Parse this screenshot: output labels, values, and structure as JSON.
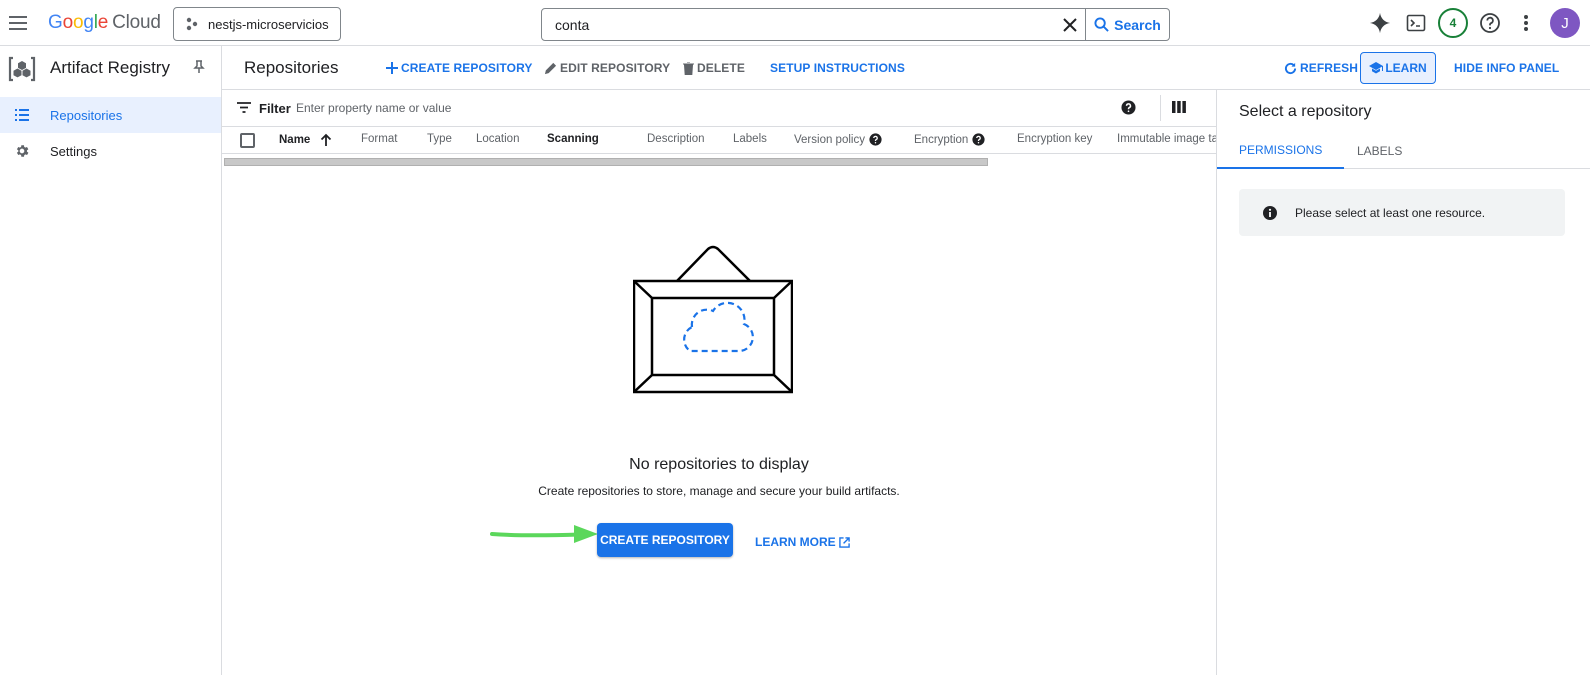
{
  "topbar": {
    "logo_parts": [
      "G",
      "o",
      "o",
      "g",
      "l",
      "e"
    ],
    "logo_cloud": "Cloud",
    "project": "nestjs-microservicios",
    "search_value": "conta",
    "search_button": "Search",
    "notifications_count": "4",
    "avatar_initial": "J"
  },
  "nav": {
    "product_title": "Artifact Registry",
    "items": [
      {
        "label": "Repositories",
        "icon": "list-icon",
        "active": true
      },
      {
        "label": "Settings",
        "icon": "gear-icon",
        "active": false
      }
    ]
  },
  "actionbar": {
    "title": "Repositories",
    "create": "CREATE REPOSITORY",
    "edit": "EDIT REPOSITORY",
    "delete": "DELETE",
    "setup": "SETUP INSTRUCTIONS",
    "refresh": "REFRESH",
    "learn": "LEARN",
    "hide_info": "HIDE INFO PANEL"
  },
  "filter": {
    "label": "Filter",
    "placeholder": "Enter property name or value"
  },
  "table": {
    "columns": [
      "Name",
      "Format",
      "Type",
      "Location",
      "Scanning",
      "Description",
      "Labels",
      "Version policy",
      "Encryption",
      "Encryption key",
      "Immutable image tags"
    ],
    "sort_column": "Name",
    "sort_direction": "ascending"
  },
  "empty_state": {
    "title": "No repositories to display",
    "subtitle": "Create repositories to store, manage and secure your build artifacts.",
    "create_button": "CREATE REPOSITORY",
    "learn_more": "LEARN MORE"
  },
  "info_panel": {
    "title": "Select a repository",
    "tabs": [
      "PERMISSIONS",
      "LABELS"
    ],
    "active_tab": "PERMISSIONS",
    "message": "Please select at least one resource."
  },
  "colors": {
    "accent": "#1a73e8",
    "annotation_arrow": "#5bd75b",
    "notification": "#188038",
    "avatar": "#7e57c2"
  }
}
